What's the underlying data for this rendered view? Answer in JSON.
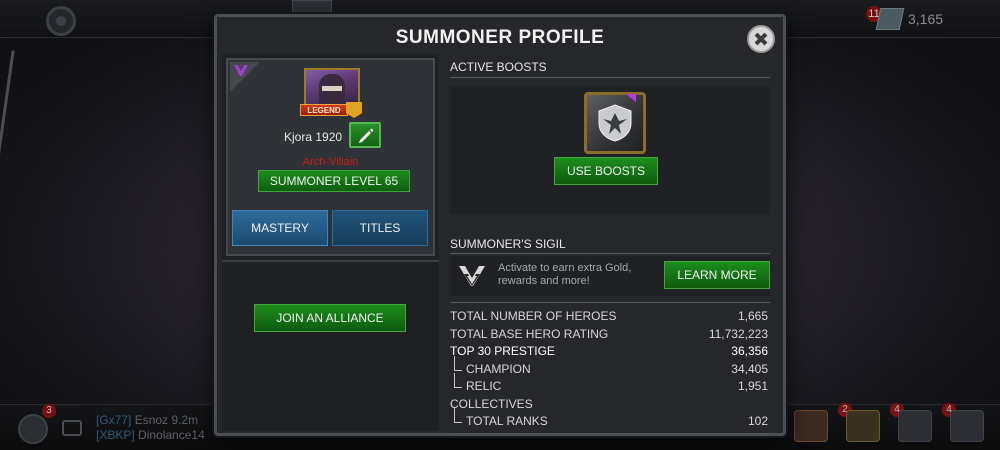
{
  "background": {
    "units_badge": "11",
    "units_count": "3,165",
    "chat_badge": "3",
    "chat_lines": [
      {
        "tag": "[Gx77]",
        "name": "Esnoz",
        "text": "9.2m"
      },
      {
        "tag": "[XBKP]",
        "name": "Dinolance14",
        "text": ""
      }
    ],
    "item_badges": [
      "2",
      "4",
      "4"
    ]
  },
  "modal": {
    "title": "SUMMONER PROFILE",
    "profile": {
      "legend_label": "LEGEND",
      "name": "Kjora 1920",
      "alignment": "Arch-Villain",
      "level": "SUMMONER LEVEL 65",
      "tabs": [
        "MASTERY",
        "TITLES"
      ],
      "join_alliance": "JOIN AN ALLIANCE"
    },
    "boosts": {
      "heading": "ACTIVE BOOSTS",
      "use_label": "USE BOOSTS"
    },
    "sigil": {
      "heading": "SUMMONER'S SIGIL",
      "description": "Activate to earn extra Gold, rewards and more!",
      "learn_more": "LEARN MORE"
    },
    "stats": [
      {
        "label": "TOTAL NUMBER OF HEROES",
        "value": "1,665"
      },
      {
        "label": "TOTAL BASE HERO RATING",
        "value": "11,732,223"
      },
      {
        "label": "TOP 30 PRESTIGE",
        "value": "36,356"
      },
      {
        "label": "CHAMPION",
        "value": "34,405"
      },
      {
        "label": "RELIC",
        "value": "1,951"
      },
      {
        "label": "COLLECTIVES",
        "value": ""
      },
      {
        "label": "TOTAL RANKS",
        "value": "102"
      }
    ]
  },
  "colors": {
    "green_button": "#146314",
    "tab_blue": "#2f6d9c",
    "villain_red": "#c8201c",
    "legend_red": "#d33a1c",
    "sigil_purple": "#9b3fd6"
  }
}
